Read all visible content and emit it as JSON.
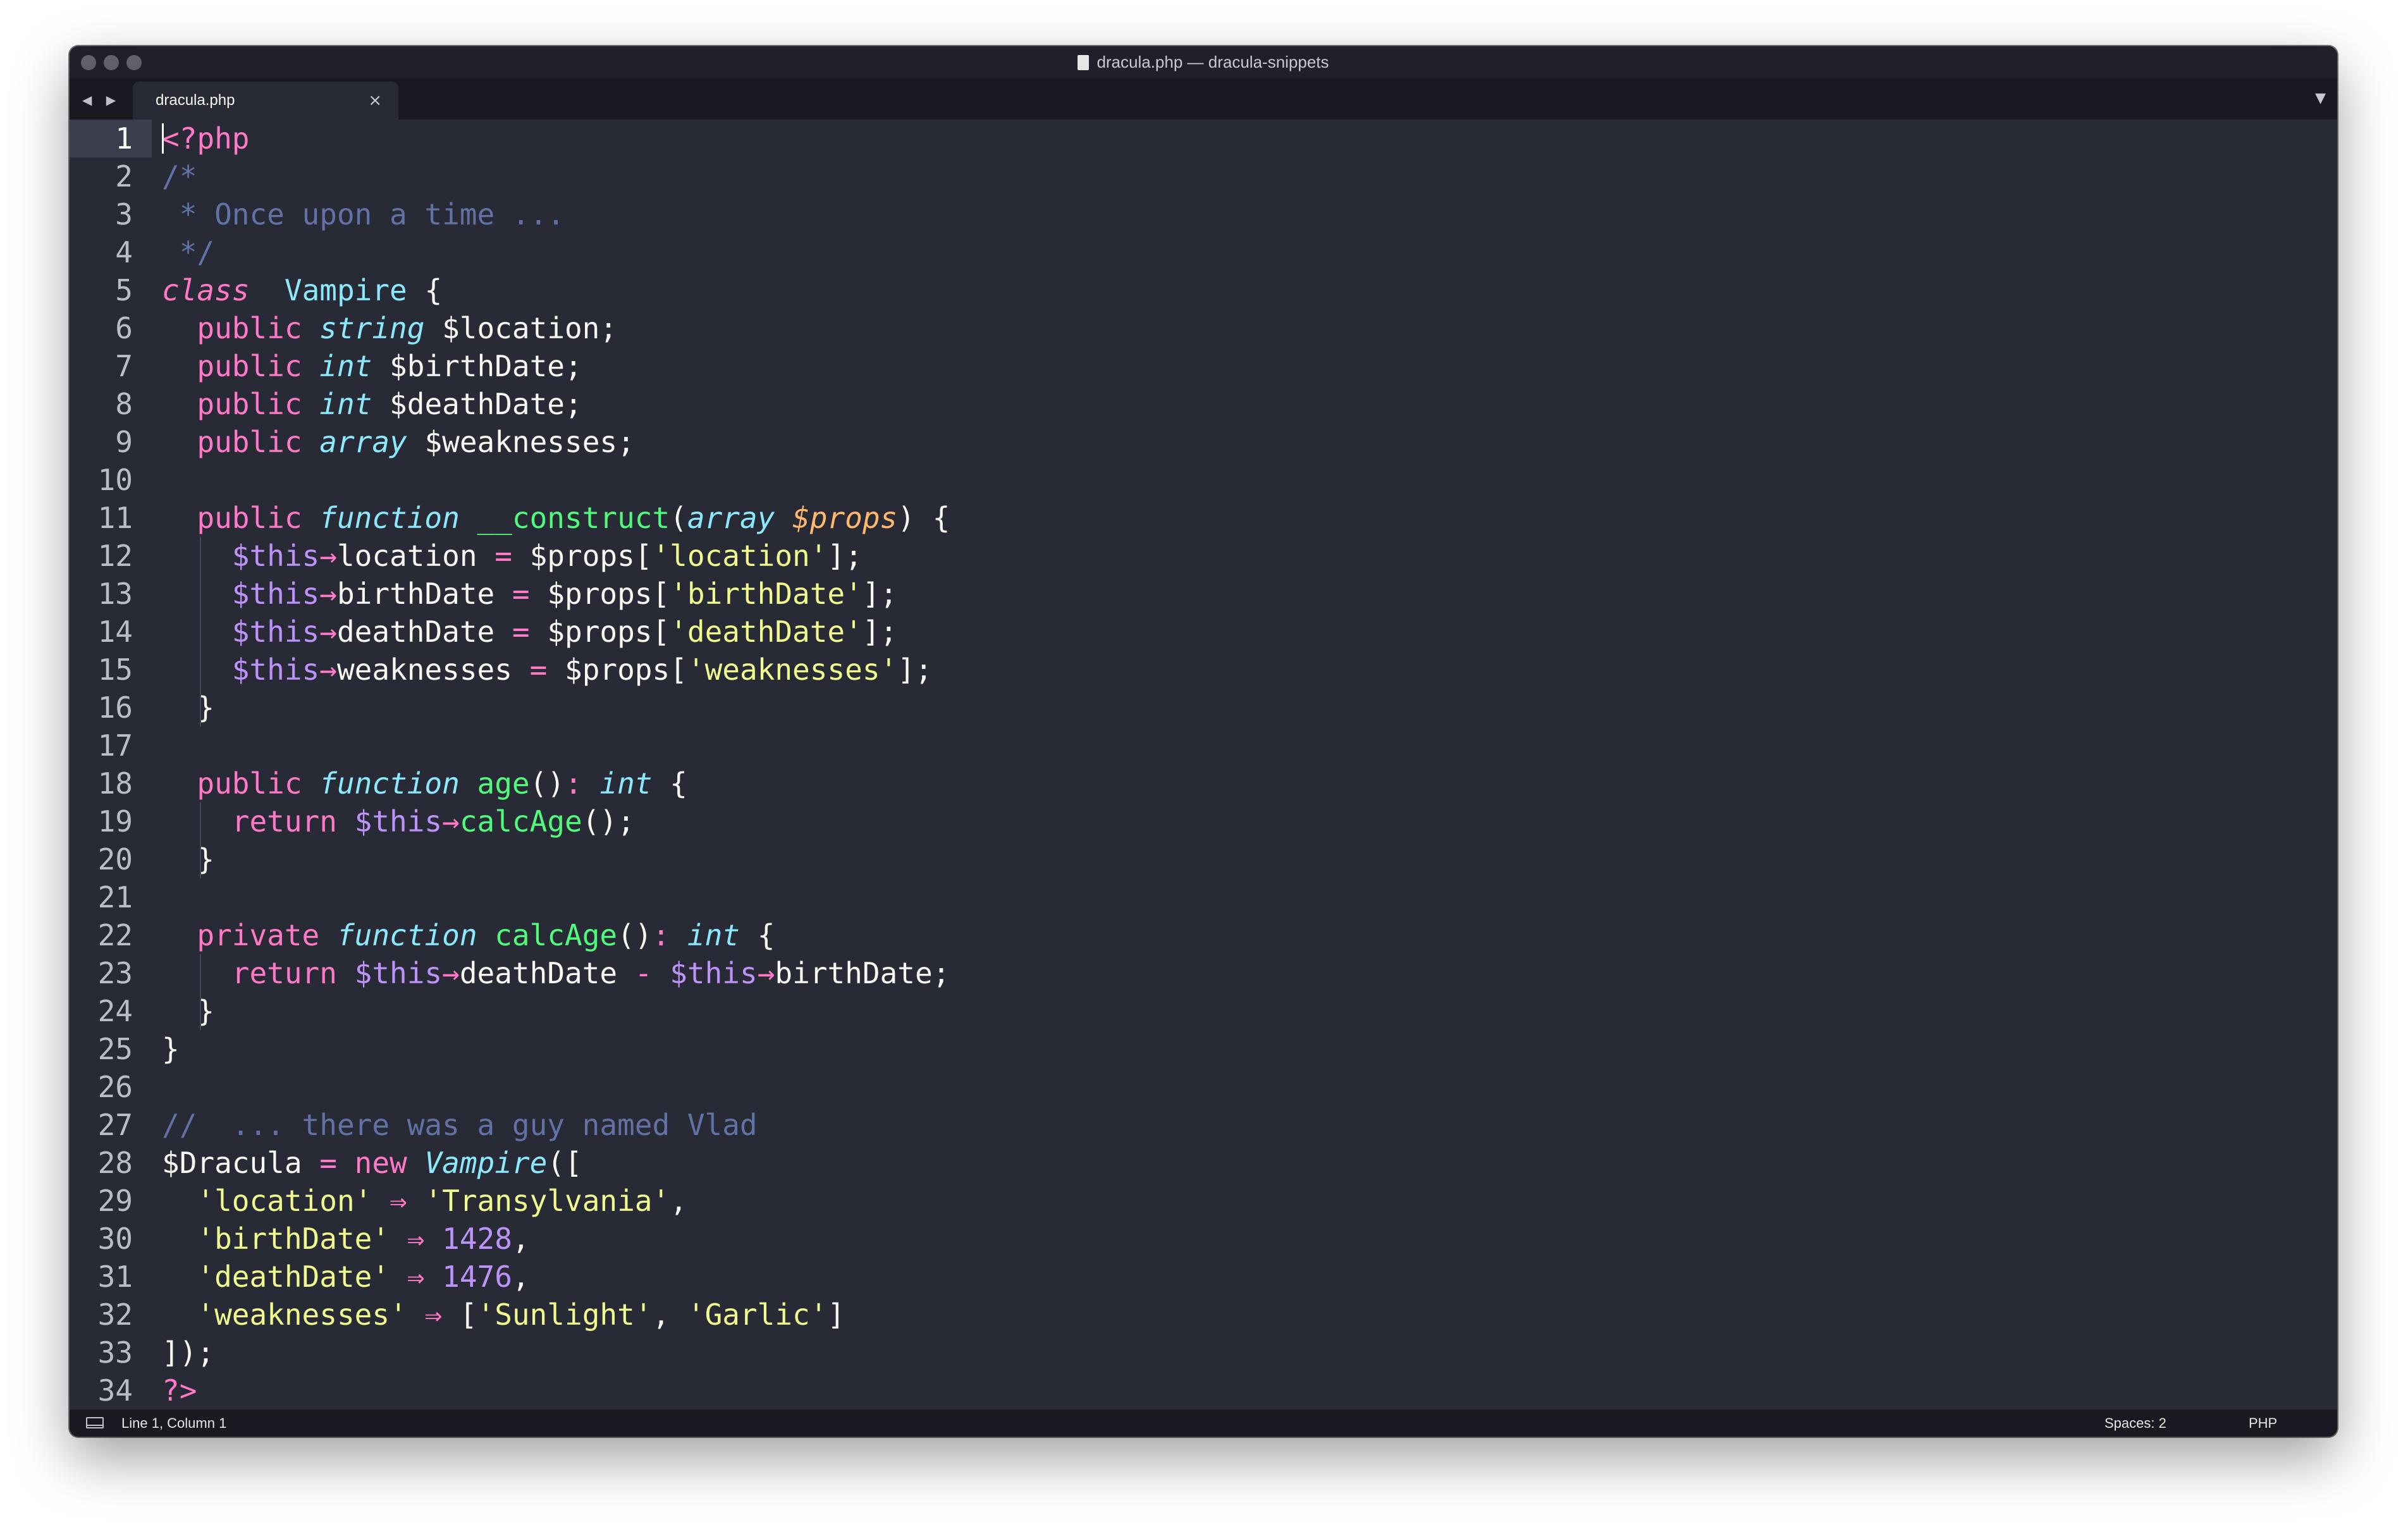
{
  "window": {
    "title": "dracula.php — dracula-snippets",
    "nav_back_forward": "◀ ▶"
  },
  "tab": {
    "label": "dracula.php",
    "close_glyph": "×",
    "menu_glyph": "▼"
  },
  "icons": [
    "traffic-light-icon",
    "document-icon",
    "nav-arrows-icon",
    "close-icon",
    "chevron-down-icon",
    "panel-toggle-icon"
  ],
  "colors": {
    "background": "#282a36",
    "current_line": "#3a3d4e",
    "foreground": "#f8f8f2",
    "comment": "#6272a4",
    "pink": "#ff79c6",
    "cyan": "#8be9fd",
    "green": "#50fa7b",
    "yellow": "#f1fa8c",
    "purple": "#bd93f9",
    "orange": "#ffb86c"
  },
  "editor": {
    "current_line": 1,
    "line_numbers": [
      "1",
      "2",
      "3",
      "4",
      "5",
      "6",
      "7",
      "8",
      "9",
      "10",
      "11",
      "12",
      "13",
      "14",
      "15",
      "16",
      "17",
      "18",
      "19",
      "20",
      "21",
      "22",
      "23",
      "24",
      "25",
      "26",
      "27",
      "28",
      "29",
      "30",
      "31",
      "32",
      "33",
      "34"
    ],
    "lines": [
      [
        [
          "k",
          "<?php"
        ]
      ],
      [
        [
          "cm",
          "/*"
        ]
      ],
      [
        [
          "cm",
          " * Once upon a time ..."
        ]
      ],
      [
        [
          "cm",
          " */"
        ]
      ],
      [
        [
          "ki",
          "class"
        ],
        [
          "",
          "  "
        ],
        [
          "c",
          "Vampire"
        ],
        [
          "",
          " {"
        ]
      ],
      [
        [
          "",
          "  "
        ],
        [
          "k",
          "public"
        ],
        [
          "",
          " "
        ],
        [
          "t",
          "string"
        ],
        [
          "",
          " $location;"
        ]
      ],
      [
        [
          "",
          "  "
        ],
        [
          "k",
          "public"
        ],
        [
          "",
          " "
        ],
        [
          "t",
          "int"
        ],
        [
          "",
          " $birthDate;"
        ]
      ],
      [
        [
          "",
          "  "
        ],
        [
          "k",
          "public"
        ],
        [
          "",
          " "
        ],
        [
          "t",
          "int"
        ],
        [
          "",
          " $deathDate;"
        ]
      ],
      [
        [
          "",
          "  "
        ],
        [
          "k",
          "public"
        ],
        [
          "",
          " "
        ],
        [
          "t",
          "array"
        ],
        [
          "",
          " $weaknesses;"
        ]
      ],
      [],
      [
        [
          "",
          "  "
        ],
        [
          "k",
          "public"
        ],
        [
          "",
          " "
        ],
        [
          "t",
          "function"
        ],
        [
          "",
          " "
        ],
        [
          "f",
          "__construct"
        ],
        [
          "",
          "("
        ],
        [
          "t",
          "array"
        ],
        [
          "",
          " "
        ],
        [
          "p",
          "$props"
        ],
        [
          "",
          ") {"
        ]
      ],
      [
        [
          "",
          "    "
        ],
        [
          "v",
          "$this"
        ],
        [
          "k",
          "→"
        ],
        [
          "",
          "location "
        ],
        [
          "k",
          "="
        ],
        [
          "",
          " $props["
        ],
        [
          "s",
          "'location'"
        ],
        [
          "",
          "];"
        ]
      ],
      [
        [
          "",
          "    "
        ],
        [
          "v",
          "$this"
        ],
        [
          "k",
          "→"
        ],
        [
          "",
          "birthDate "
        ],
        [
          "k",
          "="
        ],
        [
          "",
          " $props["
        ],
        [
          "s",
          "'birthDate'"
        ],
        [
          "",
          "];"
        ]
      ],
      [
        [
          "",
          "    "
        ],
        [
          "v",
          "$this"
        ],
        [
          "k",
          "→"
        ],
        [
          "",
          "deathDate "
        ],
        [
          "k",
          "="
        ],
        [
          "",
          " $props["
        ],
        [
          "s",
          "'deathDate'"
        ],
        [
          "",
          "];"
        ]
      ],
      [
        [
          "",
          "    "
        ],
        [
          "v",
          "$this"
        ],
        [
          "k",
          "→"
        ],
        [
          "",
          "weaknesses "
        ],
        [
          "k",
          "="
        ],
        [
          "",
          " $props["
        ],
        [
          "s",
          "'weaknesses'"
        ],
        [
          "",
          "];"
        ]
      ],
      [
        [
          "",
          "  }"
        ]
      ],
      [],
      [
        [
          "",
          "  "
        ],
        [
          "k",
          "public"
        ],
        [
          "",
          " "
        ],
        [
          "t",
          "function"
        ],
        [
          "",
          " "
        ],
        [
          "f",
          "age"
        ],
        [
          "",
          "()"
        ],
        [
          "k",
          ":"
        ],
        [
          "",
          " "
        ],
        [
          "t",
          "int"
        ],
        [
          "",
          " {"
        ]
      ],
      [
        [
          "",
          "    "
        ],
        [
          "k",
          "return"
        ],
        [
          "",
          " "
        ],
        [
          "v",
          "$this"
        ],
        [
          "k",
          "→"
        ],
        [
          "f",
          "calcAge"
        ],
        [
          "",
          "();"
        ]
      ],
      [
        [
          "",
          "  }"
        ]
      ],
      [],
      [
        [
          "",
          "  "
        ],
        [
          "k",
          "private"
        ],
        [
          "",
          " "
        ],
        [
          "t",
          "function"
        ],
        [
          "",
          " "
        ],
        [
          "f",
          "calcAge"
        ],
        [
          "",
          "()"
        ],
        [
          "k",
          ":"
        ],
        [
          "",
          " "
        ],
        [
          "t",
          "int"
        ],
        [
          "",
          " {"
        ]
      ],
      [
        [
          "",
          "    "
        ],
        [
          "k",
          "return"
        ],
        [
          "",
          " "
        ],
        [
          "v",
          "$this"
        ],
        [
          "k",
          "→"
        ],
        [
          "",
          "deathDate "
        ],
        [
          "k",
          "-"
        ],
        [
          "",
          " "
        ],
        [
          "v",
          "$this"
        ],
        [
          "k",
          "→"
        ],
        [
          "",
          "birthDate;"
        ]
      ],
      [
        [
          "",
          "  }"
        ]
      ],
      [
        [
          "",
          "}"
        ]
      ],
      [],
      [
        [
          "cm",
          "//  ... there was a guy named Vlad"
        ]
      ],
      [
        [
          "",
          "$Dracula "
        ],
        [
          "k",
          "="
        ],
        [
          "",
          " "
        ],
        [
          "k",
          "new"
        ],
        [
          "",
          " "
        ],
        [
          "t",
          "Vampire"
        ],
        [
          "",
          "(["
        ]
      ],
      [
        [
          "",
          "  "
        ],
        [
          "s",
          "'location'"
        ],
        [
          "",
          " "
        ],
        [
          "k",
          "⇒"
        ],
        [
          "",
          " "
        ],
        [
          "s",
          "'Transylvania'"
        ],
        [
          "",
          ","
        ]
      ],
      [
        [
          "",
          "  "
        ],
        [
          "s",
          "'birthDate'"
        ],
        [
          "",
          " "
        ],
        [
          "k",
          "⇒"
        ],
        [
          "",
          " "
        ],
        [
          "v",
          "1428"
        ],
        [
          "",
          ","
        ]
      ],
      [
        [
          "",
          "  "
        ],
        [
          "s",
          "'deathDate'"
        ],
        [
          "",
          " "
        ],
        [
          "k",
          "⇒"
        ],
        [
          "",
          " "
        ],
        [
          "v",
          "1476"
        ],
        [
          "",
          ","
        ]
      ],
      [
        [
          "",
          "  "
        ],
        [
          "s",
          "'weaknesses'"
        ],
        [
          "",
          " "
        ],
        [
          "k",
          "⇒"
        ],
        [
          "",
          " ["
        ],
        [
          "s",
          "'Sunlight'"
        ],
        [
          "",
          ", "
        ],
        [
          "s",
          "'Garlic'"
        ],
        [
          "",
          "]"
        ]
      ],
      [
        [
          "",
          "]);"
        ]
      ],
      [
        [
          "k",
          "?>"
        ]
      ]
    ]
  },
  "status": {
    "position": "Line 1, Column 1",
    "indentation": "Spaces: 2",
    "syntax": "PHP"
  }
}
